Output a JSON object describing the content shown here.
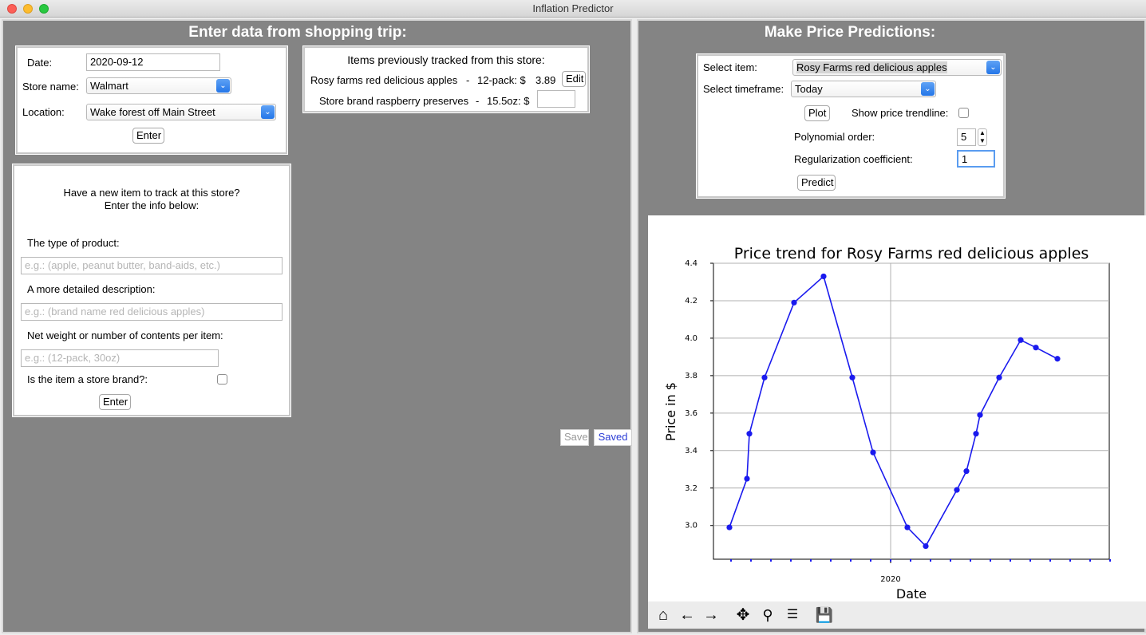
{
  "window": {
    "title": "Inflation Predictor"
  },
  "left": {
    "heading": "Enter data from shopping trip:",
    "trip": {
      "date_label": "Date:",
      "date_value": "2020-09-12",
      "store_label": "Store name:",
      "store_value": "Walmart",
      "location_label": "Location:",
      "location_value": "Wake forest off Main Street",
      "enter_label": "Enter"
    },
    "tracked": {
      "title": "Items previously tracked from this store:",
      "items": [
        {
          "name": "Rosy farms red delicious apples",
          "sep": "-",
          "size": "12-pack: $",
          "price": "3.89",
          "button": "Edit"
        },
        {
          "name": "Store brand raspberry preserves",
          "sep": "-",
          "size": "15.5oz: $",
          "price": ""
        }
      ]
    },
    "new_item": {
      "intro_line1": "Have a new item to track at this store?",
      "intro_line2": "Enter the info below:",
      "type_label": "The type of product:",
      "type_placeholder": "e.g.: (apple, peanut butter, band-aids, etc.)",
      "desc_label": "A more detailed description:",
      "desc_placeholder": "e.g.: (brand name red delicious apples)",
      "weight_label": "Net weight or number of contents per item:",
      "weight_placeholder": "e.g.: (12-pack, 30oz)",
      "store_brand_label": "Is the item a store brand?:",
      "enter_label": "Enter"
    },
    "save_label": "Save",
    "saved_label": "Saved"
  },
  "right": {
    "heading": "Make Price Predictions:",
    "controls": {
      "item_label": "Select item:",
      "item_value": "Rosy Farms red delicious apples",
      "timeframe_label": "Select timeframe:",
      "timeframe_value": "Today",
      "plot_label": "Plot",
      "trendline_label": "Show price trendline:",
      "poly_label": "Polynomial order:",
      "poly_value": "5",
      "reg_label": "Regularization coefficient:",
      "reg_value": "1",
      "predict_label": "Predict"
    },
    "toolbar": [
      "home-icon",
      "back-arrow-icon",
      "forward-arrow-icon",
      "pan-icon",
      "zoom-icon",
      "configure-icon",
      "save-icon"
    ]
  },
  "chart_data": {
    "type": "line",
    "title": "Price trend for Rosy Farms red delicious apples",
    "xlabel": "Date",
    "ylabel": "Price in $",
    "x_tick_labels": [
      "2020"
    ],
    "y_ticks": [
      "3.0",
      "3.2",
      "3.4",
      "3.6",
      "3.8",
      "4.0",
      "4.2",
      "4.4"
    ],
    "ylim": [
      2.82,
      4.4
    ],
    "grid": true,
    "color": "#1a1aee",
    "series": [
      {
        "values": [
          2.99,
          3.25,
          3.49,
          3.79,
          4.19,
          4.33,
          3.79,
          3.39,
          2.99,
          2.89,
          3.19,
          3.29,
          3.49,
          3.59,
          3.79,
          3.99,
          3.95,
          3.89
        ]
      }
    ]
  }
}
